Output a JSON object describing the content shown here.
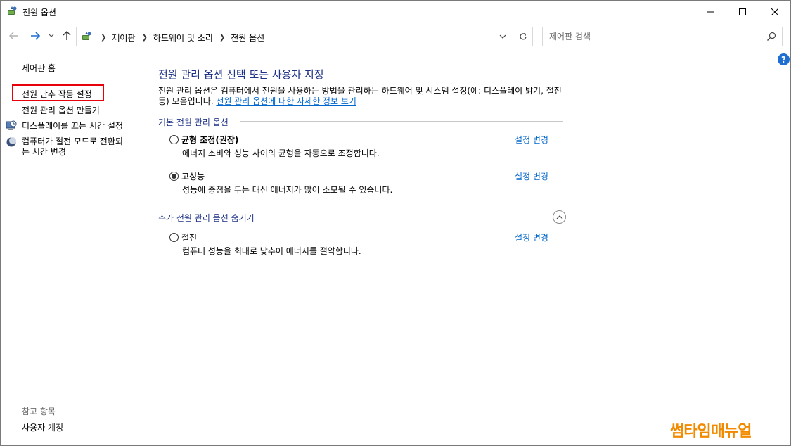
{
  "window": {
    "title": "전원 옵션"
  },
  "address_bar": {
    "crumbs": [
      "제어판",
      "하드웨어 및 소리",
      "전원 옵션"
    ]
  },
  "search": {
    "placeholder": "제어판 검색"
  },
  "help_label": "?",
  "left_pane": {
    "home": "제어판 홈",
    "power_button": "전원 단추 작동 설정",
    "create_plan": "전원 관리 옵션 만들기",
    "display_off": "디스플레이를 끄는 시간 설정",
    "sleep_line1": "컴퓨터가 절전 모드로 전환되",
    "sleep_line2": "는 시간 변경",
    "see_also": "참고 항목",
    "user_accounts": "사용자 계정"
  },
  "main": {
    "title": "전원 관리 옵션 선택 또는 사용자 지정",
    "description": "전원 관리 옵션은 컴퓨터에서 전원을 사용하는 방법을 관리하는 하드웨어 및 시스템 설정(예: 디스플레이 밝기, 절전 등) 모음입니다. ",
    "info_link": "전원 관리 옵션에 대한 자세한 정보 보기",
    "basic_section": "기본 전원 관리 옵션",
    "extra_section": "추가 전원 관리 옵션 숨기기",
    "change_label": "설정 변경",
    "plans": [
      {
        "name": "균형 조정(권장)",
        "desc": "에너지 소비와 성능 사이의 균형을 자동으로 조정합니다.",
        "selected": false
      },
      {
        "name": "고성능",
        "desc": "성능에 중점을 두는 대신 에너지가 많이 소모될 수 있습니다.",
        "selected": true
      },
      {
        "name": "절전",
        "desc": "컴퓨터 성능을 최대로 낮추어 에너지를 절약합니다.",
        "selected": false
      }
    ]
  },
  "watermark": "썸타임매뉴얼",
  "colors": {
    "accent_title": "#1e3287",
    "link": "#0066cc",
    "highlight": "#e8000a",
    "watermark": "#f28a00"
  }
}
